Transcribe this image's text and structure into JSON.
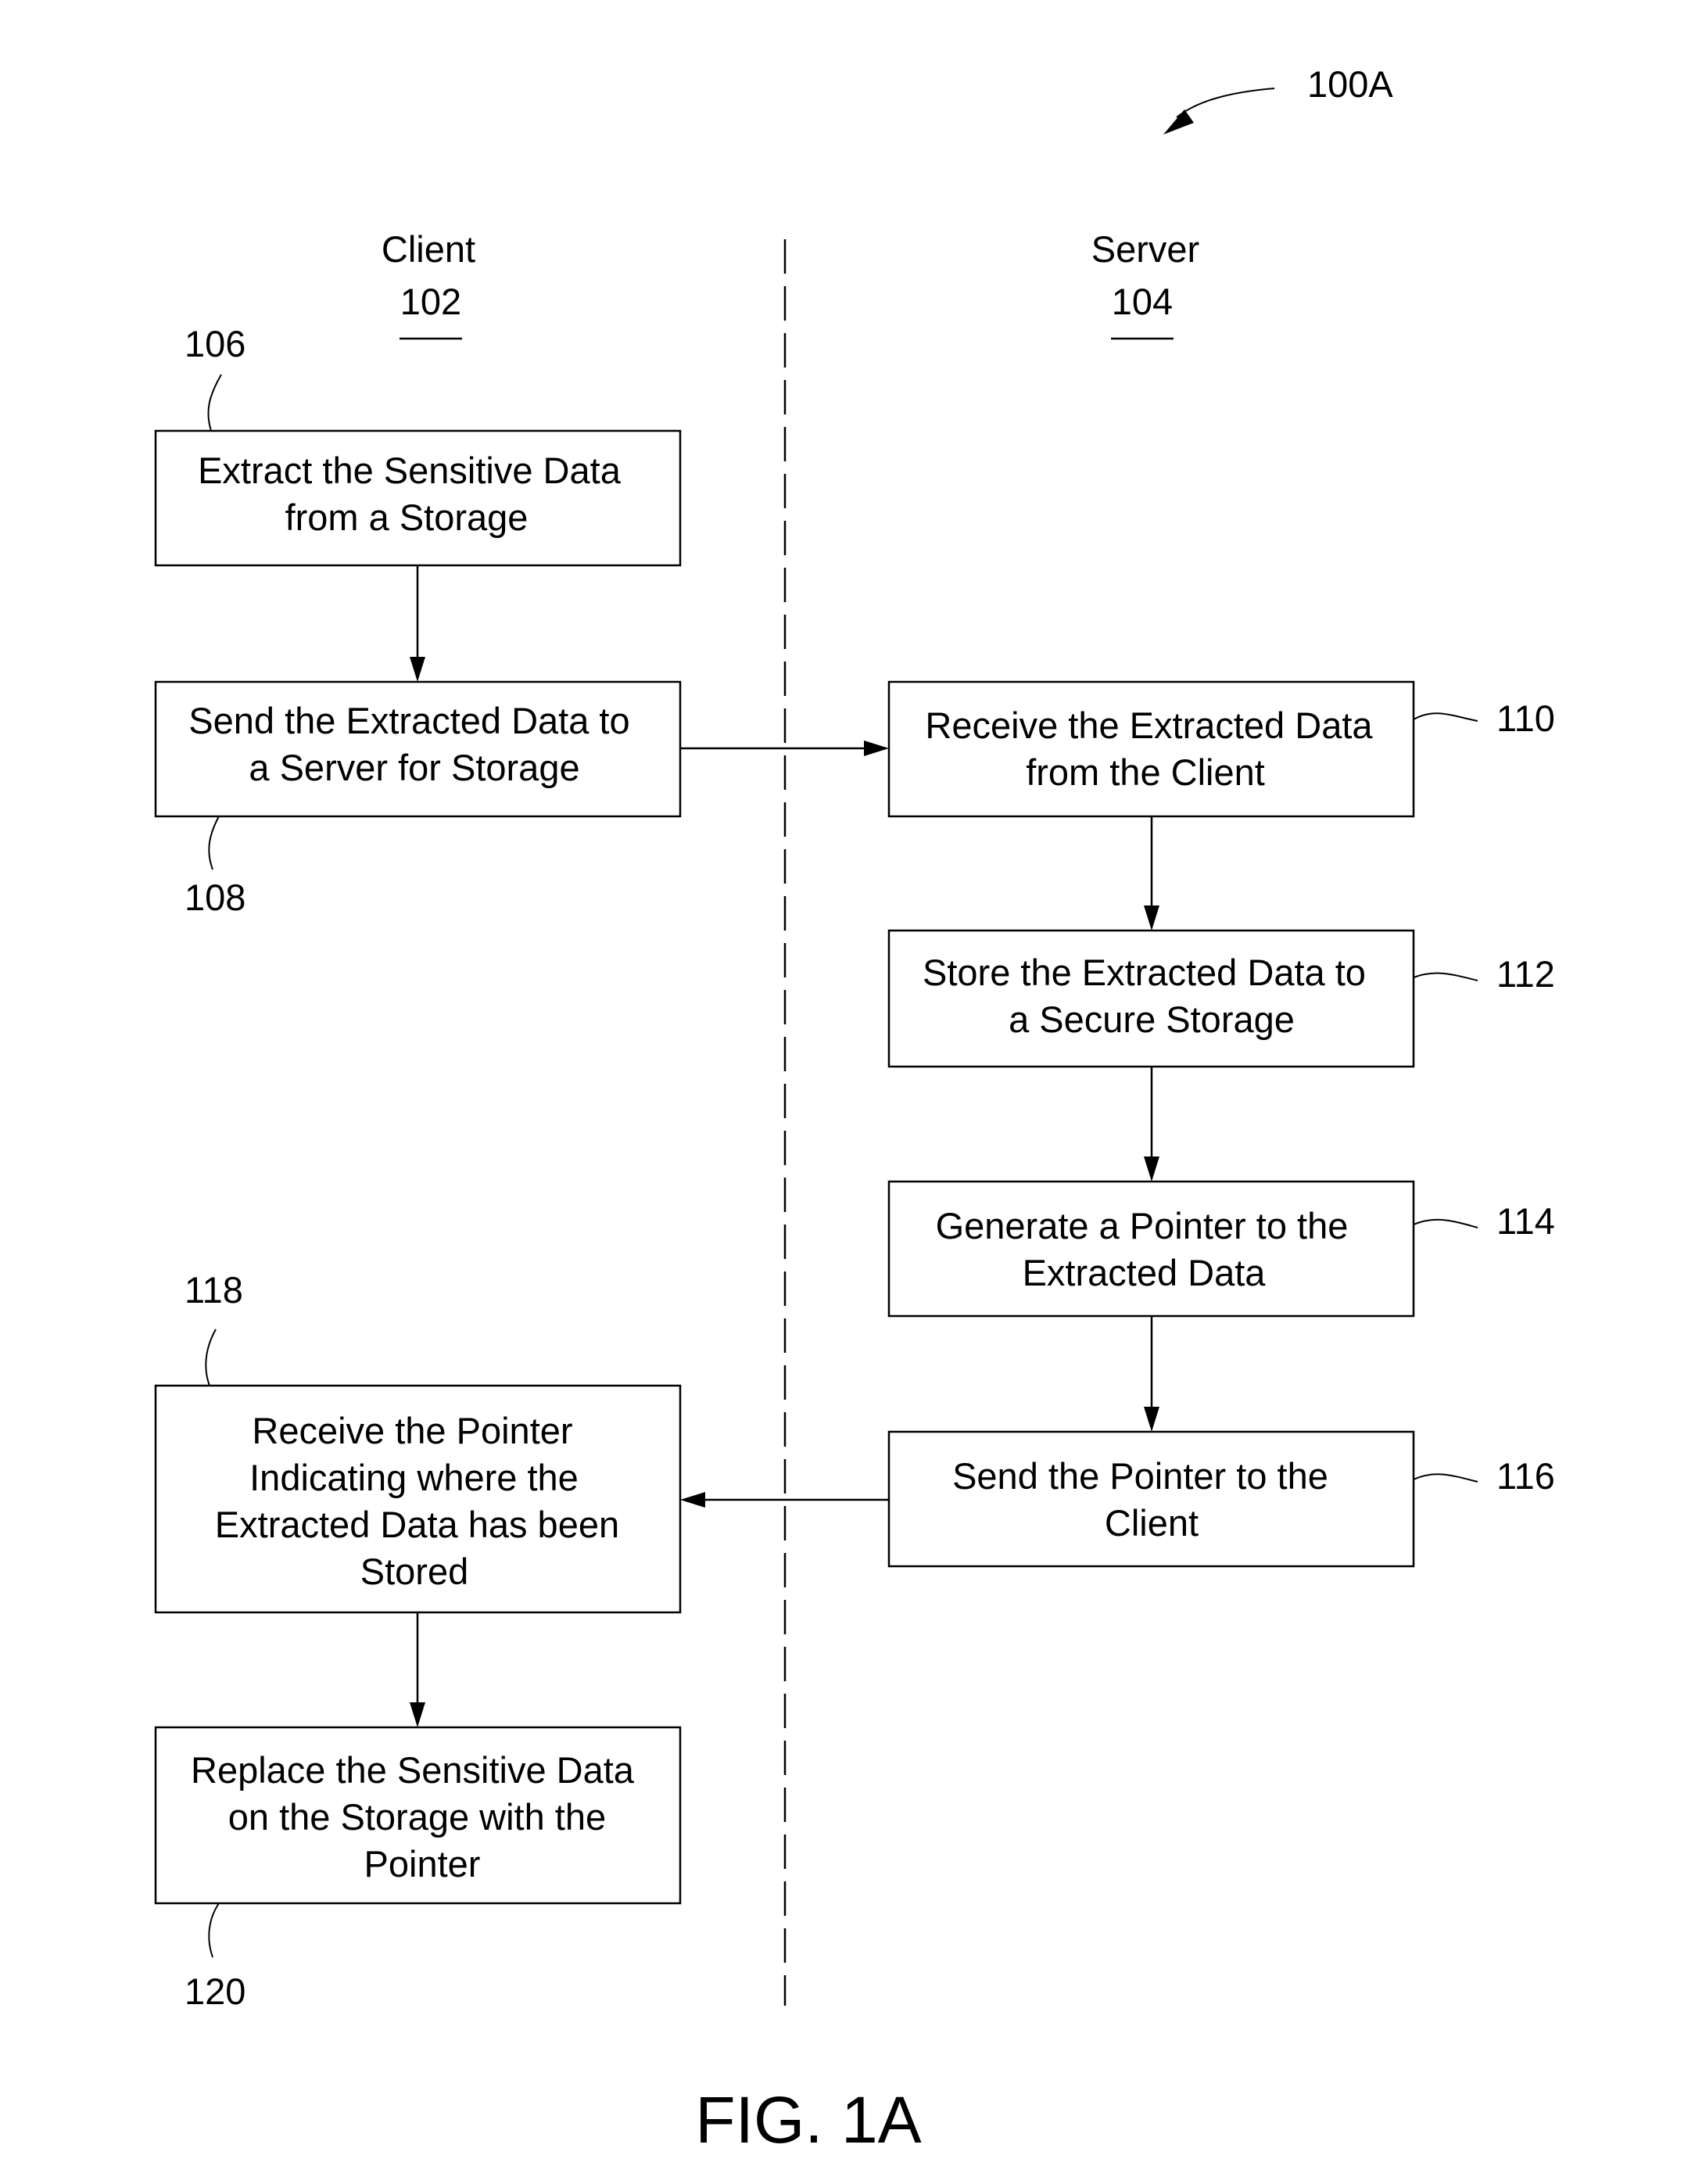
{
  "figure": {
    "reference": "100A",
    "caption": "FIG. 1A"
  },
  "lanes": {
    "client": {
      "title": "Client",
      "ref": "102"
    },
    "server": {
      "title": "Server",
      "ref": "104"
    }
  },
  "steps": {
    "s106": {
      "ref": "106",
      "lines": [
        "Extract the Sensitive Data",
        "from a Storage"
      ]
    },
    "s108": {
      "ref": "108",
      "lines": [
        "Send the Extracted Data to",
        "a Server for Storage"
      ]
    },
    "s110": {
      "ref": "110",
      "lines": [
        "Receive the Extracted Data",
        "from the Client"
      ]
    },
    "s112": {
      "ref": "112",
      "lines": [
        "Store the Extracted Data to",
        "a Secure Storage"
      ]
    },
    "s114": {
      "ref": "114",
      "lines": [
        "Generate a Pointer to the",
        "Extracted Data"
      ]
    },
    "s116": {
      "ref": "116",
      "lines": [
        "Send the Pointer to the",
        "Client"
      ]
    },
    "s118": {
      "ref": "118",
      "lines": [
        "Receive the Pointer",
        "Indicating where the",
        "Extracted Data has been",
        "Stored"
      ]
    },
    "s120": {
      "ref": "120",
      "lines": [
        "Replace the Sensitive Data",
        "on the Storage with the",
        "Pointer"
      ]
    }
  },
  "flow": [
    {
      "from": "106",
      "to": "108"
    },
    {
      "from": "108",
      "to": "110"
    },
    {
      "from": "110",
      "to": "112"
    },
    {
      "from": "112",
      "to": "114"
    },
    {
      "from": "114",
      "to": "116"
    },
    {
      "from": "116",
      "to": "118"
    },
    {
      "from": "118",
      "to": "120"
    }
  ]
}
